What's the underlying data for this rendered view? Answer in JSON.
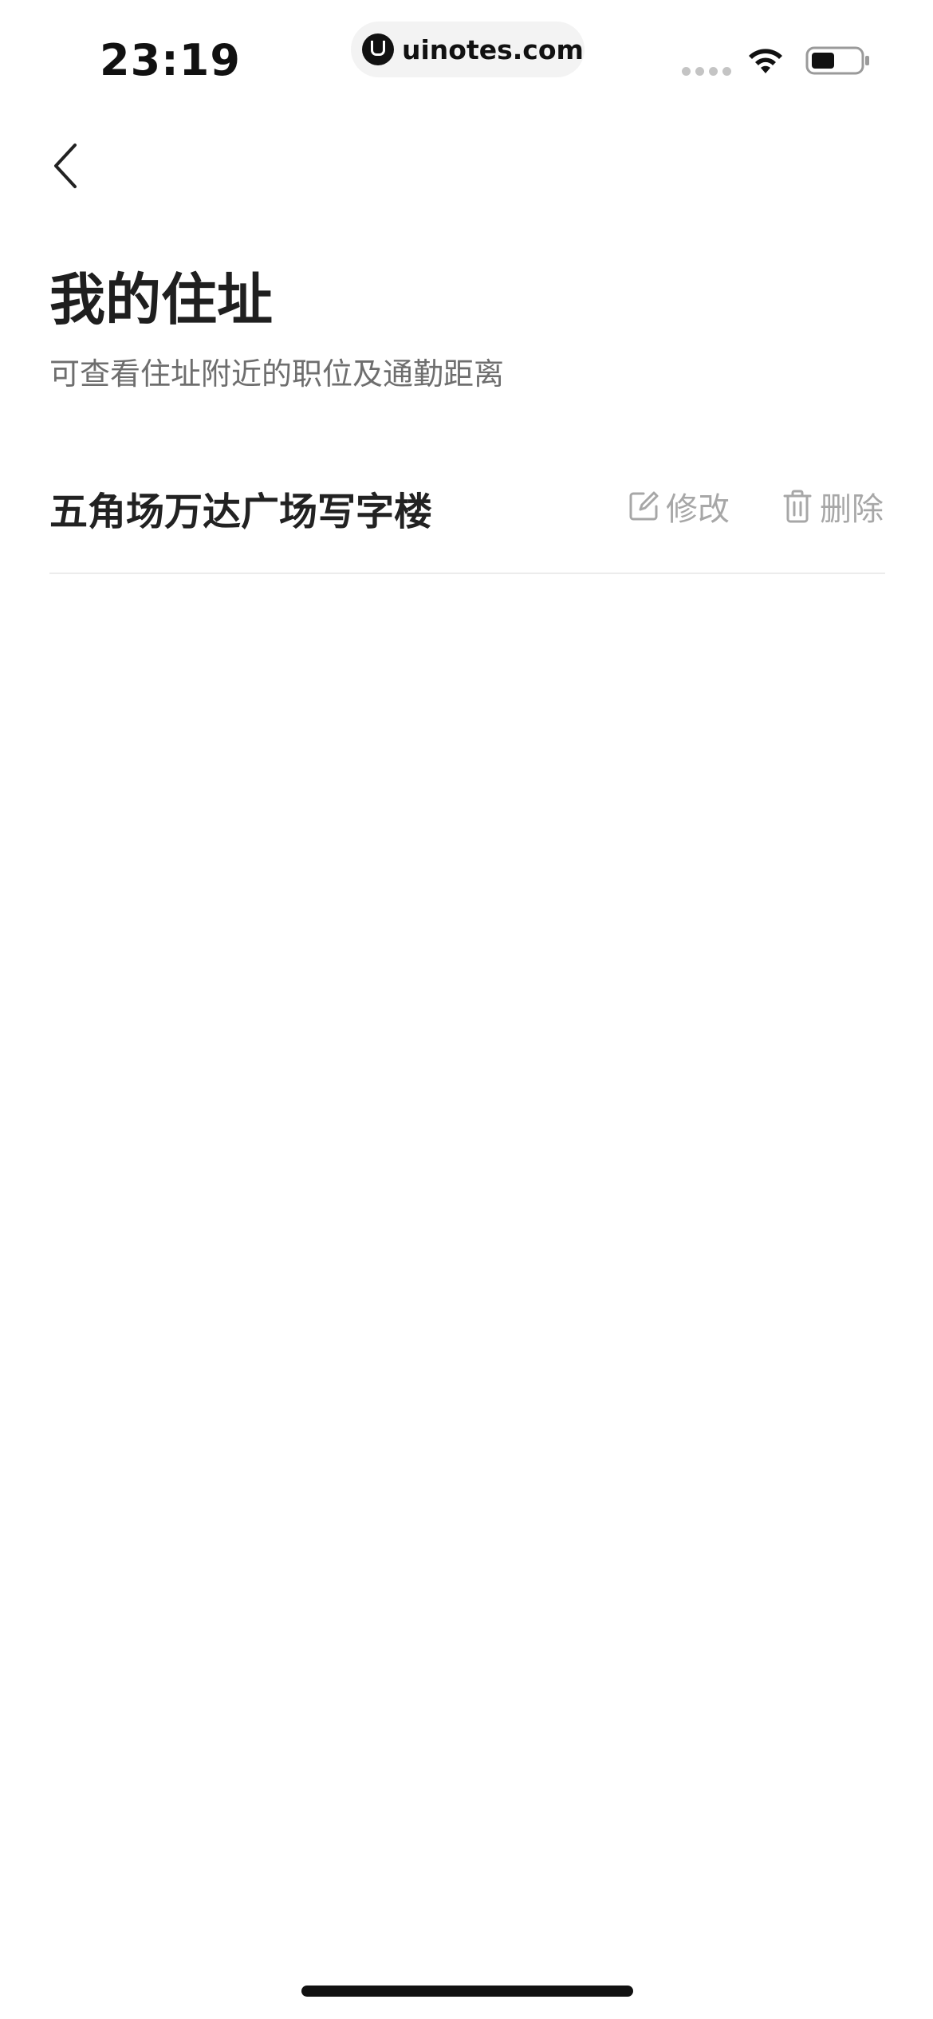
{
  "status_bar": {
    "time": "23:19",
    "url": "uinotes.com",
    "icons": [
      "signal-icon",
      "wifi-icon",
      "battery-icon"
    ]
  },
  "nav": {
    "back_icon": "chevron-left-icon"
  },
  "header": {
    "title": "我的住址",
    "subtitle": "可查看住址附近的职位及通勤距离"
  },
  "addresses": [
    {
      "name": "五角场万达广场写字楼",
      "edit_label": "修改",
      "delete_label": "删除"
    }
  ],
  "colors": {
    "title": "#1f1f1f",
    "subtitle": "#6e6e6e",
    "action": "#a7a7a7",
    "divider": "#ececec"
  }
}
